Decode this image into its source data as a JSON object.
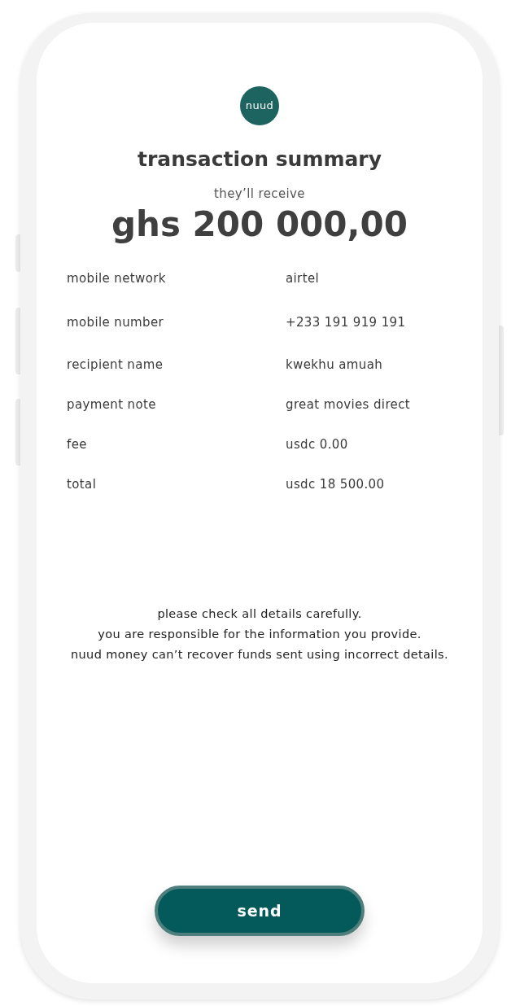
{
  "logo": {
    "text": "nuud"
  },
  "title": "transaction summary",
  "amount": {
    "label": "they’ll receive",
    "value": "ghs 200 000,00"
  },
  "details": [
    {
      "label": "mobile network",
      "value": "airtel"
    },
    {
      "label": "mobile number",
      "value": "+233 191 919 191"
    },
    {
      "label": "recipient name",
      "value": "kwekhu amuah"
    },
    {
      "label": "payment note",
      "value": "great movies direct"
    },
    {
      "label": "fee",
      "value": "usdc 0.00"
    },
    {
      "label": "total",
      "value": "usdc 18 500.00"
    }
  ],
  "notice": "please check all details carefully.\nyou are responsible for the information you provide.\nnuud money can’t recover funds sent using incorrect details.",
  "send_button": "send"
}
